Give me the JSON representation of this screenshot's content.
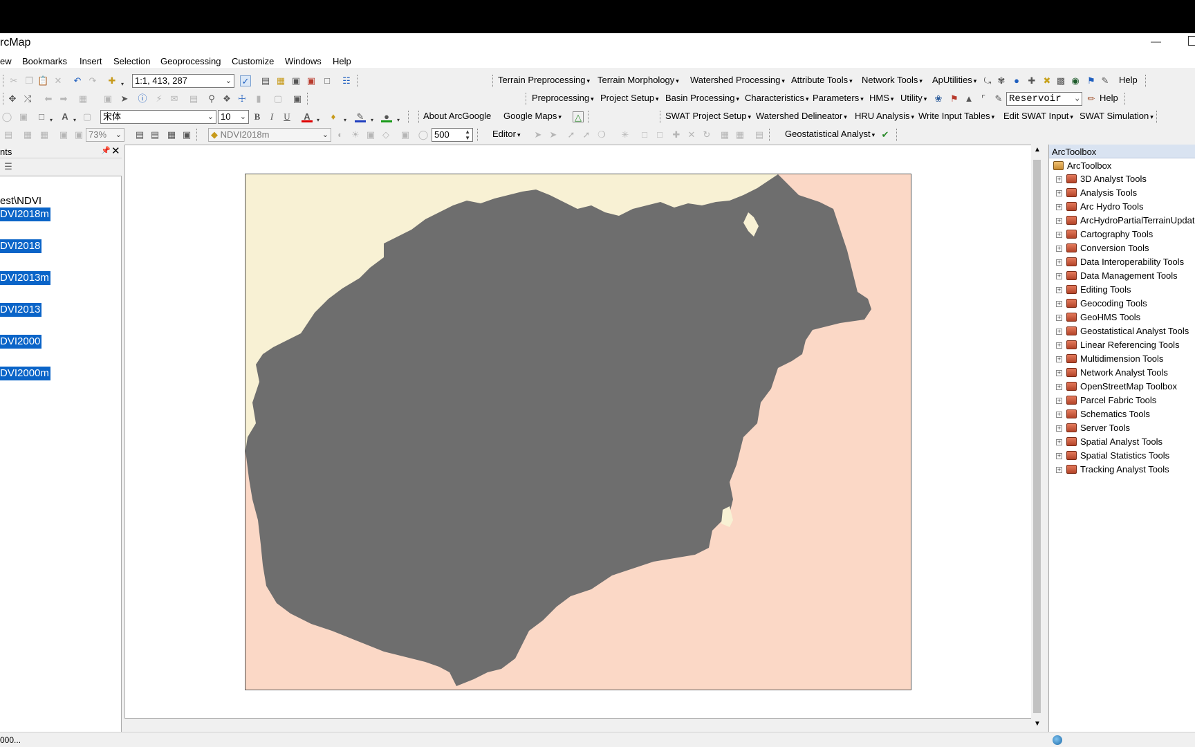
{
  "window": {
    "title": "rcMap"
  },
  "menu": [
    "ew",
    "Bookmarks",
    "Insert",
    "Selection",
    "Geoprocessing",
    "Customize",
    "Windows",
    "Help"
  ],
  "toolbar1": {
    "scale": "1:1, 413, 287",
    "extensions": [
      "Terrain Preprocessing",
      "Terrain Morphology",
      "Watershed Processing",
      "Attribute Tools",
      "Network Tools",
      "ApUtilities"
    ],
    "help": "Help"
  },
  "toolbar2": {
    "extensions": [
      "Preprocessing",
      "Project Setup",
      "Basin Processing",
      "Characteristics",
      "Parameters",
      "HMS",
      "Utility"
    ],
    "reservoir": "Reservoir",
    "help": "Help"
  },
  "toolbar3": {
    "font": "宋体",
    "font_size": "10",
    "about_arcgoogle": "About ArcGoogle",
    "google_maps": "Google Maps",
    "swat": [
      "SWAT Project Setup",
      "Watershed Delineator",
      "HRU Analysis",
      "Write Input Tables",
      "Edit SWAT Input",
      "SWAT Simulation"
    ]
  },
  "toolbar4": {
    "zoom": "73%",
    "layer": "NDVI2018m",
    "value": "500",
    "editor": "Editor",
    "geostat": "Geostatistical Analyst"
  },
  "toc": {
    "header": "nts",
    "folder": "est\\NDVI",
    "layers": [
      "DVI2018m",
      "DVI2018",
      "DVI2013m",
      "DVI2013",
      "DVI2000",
      "DVI2000m"
    ]
  },
  "toolbox": {
    "title": "ArcToolbox",
    "root": "ArcToolbox",
    "items": [
      "3D Analyst Tools",
      "Analysis Tools",
      "Arc Hydro Tools",
      "ArcHydroPartialTerrainUpdat",
      "Cartography Tools",
      "Conversion Tools",
      "Data Interoperability Tools",
      "Data Management Tools",
      "Editing Tools",
      "Geocoding Tools",
      "GeoHMS Tools",
      "Geostatistical Analyst Tools",
      "Linear Referencing Tools",
      "Multidimension Tools",
      "Network Analyst Tools",
      "OpenStreetMap Toolbox",
      "Parcel Fabric Tools",
      "Schematics Tools",
      "Server Tools",
      "Spatial Analyst Tools",
      "Spatial Statistics Tools",
      "Tracking Analyst Tools"
    ]
  },
  "status": {
    "text": "000..."
  },
  "colors": {
    "land": "#6e6e6e",
    "sea": "#fbd8c6",
    "north": "#f8f1d4",
    "selection": "#0a64c8"
  }
}
